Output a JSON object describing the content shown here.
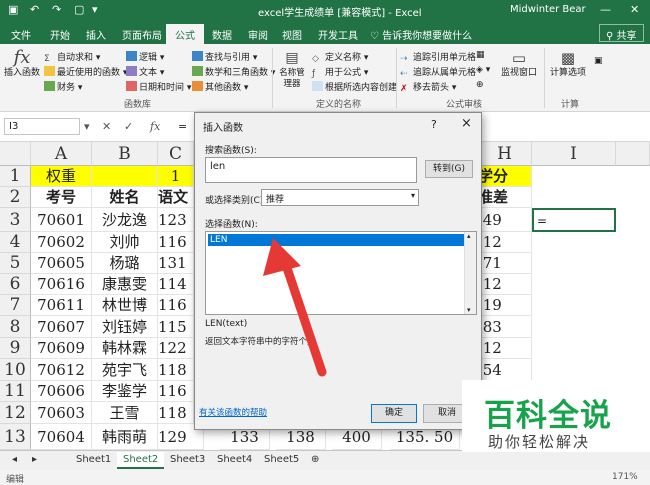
{
  "titlebar": {
    "title": "excel学生成绩单 [兼容模式] - Excel",
    "user": "Midwinter Bear"
  },
  "tabs": [
    "文件",
    "开始",
    "插入",
    "页面布局",
    "公式",
    "数据",
    "审阅",
    "视图",
    "开发工具"
  ],
  "active_tab": "公式",
  "tell_me": "告诉我你想要做什么",
  "share": "共享",
  "ribbon": {
    "insert_function": "插入函数",
    "library": {
      "col1": [
        "自动求和",
        "最近使用的函数",
        "财务"
      ],
      "col2": [
        "逻辑",
        "文本",
        "日期和时间"
      ],
      "col3": [
        "查找与引用",
        "数学和三角函数",
        "其他函数"
      ],
      "label": "函数库"
    },
    "name_manager": "名称管理器",
    "names": {
      "items": [
        "定义名称",
        "用于公式",
        "根据所选内容创建"
      ],
      "label": "定义的名称"
    },
    "audit": {
      "items": [
        "追踪引用单元格",
        "追踪从属单元格",
        "移去箭头"
      ],
      "label": "公式审核"
    },
    "watch": "监视窗口",
    "calc_options": "计算选项",
    "calc_label": "计算"
  },
  "formula_bar": {
    "name_box": "I3",
    "fx": "fx",
    "value": "="
  },
  "columns": [
    "A",
    "B",
    "C",
    "H",
    "I"
  ],
  "rows": [
    "1",
    "2",
    "3",
    "4",
    "5",
    "6",
    "7",
    "8",
    "9",
    "10",
    "11",
    "12",
    "13"
  ],
  "grid": {
    "r1": {
      "a": "权重",
      "c": "1",
      "h": "学分"
    },
    "r2": {
      "a": "考号",
      "b": "姓名",
      "c": "语文",
      "h": "准差"
    },
    "data": [
      [
        "70601",
        "沙龙逸",
        "123",
        ".49"
      ],
      [
        "70602",
        "刘帅",
        "116",
        ".12"
      ],
      [
        "70605",
        "杨璐",
        "131",
        ".71"
      ],
      [
        "70616",
        "康惠雯",
        "114",
        ".12"
      ],
      [
        "70611",
        "林世博",
        "116",
        ".19"
      ],
      [
        "70607",
        "刘钰婷",
        "115",
        ".83"
      ],
      [
        "70609",
        "韩林霖",
        "122",
        ".12"
      ],
      [
        "70612",
        "苑宇飞",
        "118",
        ".54"
      ],
      [
        "70606",
        "李鉴学",
        "116",
        ""
      ],
      [
        "70603",
        "王雪",
        "118",
        ""
      ]
    ],
    "r13": [
      "70604",
      "韩雨萌",
      "129",
      "133",
      "138",
      "400",
      "135. 50"
    ],
    "active_cell_value": "="
  },
  "dialog": {
    "title": "插入函数",
    "help": "?",
    "close": "×",
    "search_label": "搜索函数(S):",
    "search_value": "len",
    "go": "转到(G)",
    "category_label": "或选择类别(C):",
    "category_value": "推荐",
    "select_label": "选择函数(N):",
    "selected": "LEN",
    "signature": "LEN(text)",
    "description": "返回文本字符串中的字符个数",
    "help_link": "有关该函数的帮助",
    "ok": "确定",
    "cancel": "取消"
  },
  "sheets": [
    "Sheet1",
    "Sheet2",
    "Sheet3",
    "Sheet4",
    "Sheet5"
  ],
  "active_sheet": "Sheet2",
  "status": {
    "mode": "编辑",
    "zoom": "171%"
  },
  "watermark": {
    "title": "百科全说",
    "subtitle": "助你轻松解决"
  },
  "colors": {
    "excel_green": "#217346",
    "accent_blue": "#0078d7",
    "arrow_red": "#e53935",
    "header_yellow": "#ffff00"
  }
}
